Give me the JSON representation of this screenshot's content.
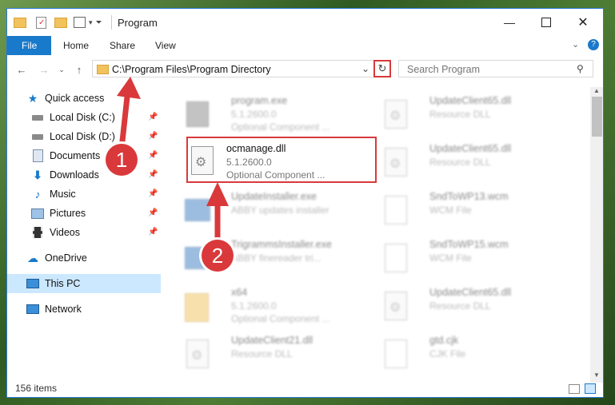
{
  "window": {
    "title": "Program"
  },
  "ribbon": {
    "tabs": [
      "File",
      "Home",
      "Share",
      "View"
    ]
  },
  "address": {
    "path": "C:\\Program Files\\Program Directory"
  },
  "search": {
    "placeholder": "Search Program"
  },
  "nav": {
    "items": [
      {
        "label": "Quick access",
        "icon": "star-icon"
      },
      {
        "label": "Local Disk (C:)",
        "icon": "drive-icon",
        "pinned": true
      },
      {
        "label": "Local Disk (D:)",
        "icon": "drive-icon",
        "pinned": true
      },
      {
        "label": "Documents",
        "icon": "documents-icon",
        "pinned": true
      },
      {
        "label": "Downloads",
        "icon": "download-icon",
        "pinned": true
      },
      {
        "label": "Music",
        "icon": "music-icon",
        "pinned": true
      },
      {
        "label": "Pictures",
        "icon": "pictures-icon",
        "pinned": true
      },
      {
        "label": "Videos",
        "icon": "videos-icon",
        "pinned": true
      },
      {
        "label": "OneDrive",
        "icon": "cloud-icon"
      },
      {
        "label": "This PC",
        "icon": "computer-icon",
        "selected": true
      },
      {
        "label": "Network",
        "icon": "network-icon"
      }
    ]
  },
  "files": [
    {
      "name": "program.exe",
      "line2": "5.1.2600.0",
      "line3": "Optional Component ...",
      "icon": "exe-icon"
    },
    {
      "name": "UpdateClient65.dll",
      "line2": "Resource DLL",
      "line3": "",
      "icon": "dll-icon"
    },
    {
      "name": "ocmanage.dll",
      "line2": "5.1.2600.0",
      "line3": "Optional Component ...",
      "icon": "dll-icon",
      "highlighted": true
    },
    {
      "name": "UpdateClient65.dll",
      "line2": "Resource DLL",
      "line3": "",
      "icon": "dll-icon"
    },
    {
      "name": "UpdateInstaller.exe",
      "line2": "ABBY updates installer",
      "line3": "",
      "icon": "exe-icon"
    },
    {
      "name": "SndToWP13.wcm",
      "line2": "WCM File",
      "line3": "",
      "icon": "file-icon"
    },
    {
      "name": "TrigrammsInstaller.exe",
      "line2": "ABBY finereader tri...",
      "line3": "",
      "icon": "exe-icon"
    },
    {
      "name": "SndToWP15.wcm",
      "line2": "WCM File",
      "line3": "",
      "icon": "file-icon"
    },
    {
      "name": "x64",
      "line2": "5.1.2600.0",
      "line3": "Optional Component ...",
      "icon": "folder-icon"
    },
    {
      "name": "UpdateClient65.dll",
      "line2": "Resource DLL",
      "line3": "",
      "icon": "dll-icon"
    },
    {
      "name": "UpdateClient21.dll",
      "line2": "Resource DLL",
      "line3": "",
      "icon": "dll-icon"
    },
    {
      "name": "gtd.cjk",
      "line2": "CJK File",
      "line3": "",
      "icon": "file-icon"
    }
  ],
  "status": {
    "item_count": "156 items"
  },
  "annotations": [
    "1",
    "2"
  ],
  "colors": {
    "accent": "#1979ca",
    "annotation": "#d9393b",
    "selected": "#cce8ff"
  }
}
